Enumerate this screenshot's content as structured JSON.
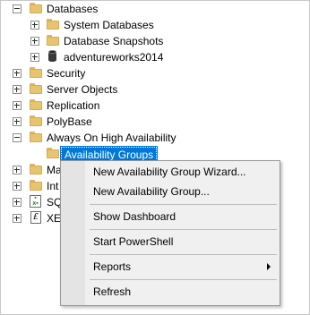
{
  "tree": {
    "databases": "Databases",
    "system_databases": "System Databases",
    "database_snapshots": "Database Snapshots",
    "adventureworks": "adventureworks2014",
    "security": "Security",
    "server_objects": "Server Objects",
    "replication": "Replication",
    "polybase": "PolyBase",
    "always_on": "Always On High Availability",
    "availability_groups": "Availability Groups",
    "management_partial": "Ma",
    "integration_partial": "Int",
    "sql_agent_partial": "SQ",
    "xevent_partial": "XE"
  },
  "menu": {
    "new_ag_wizard": "New Availability Group Wizard...",
    "new_ag": "New Availability Group...",
    "show_dashboard": "Show Dashboard",
    "start_powershell": "Start PowerShell",
    "reports": "Reports",
    "refresh": "Refresh"
  },
  "colors": {
    "selection": "#0078d7",
    "folder": "#e8c46f",
    "menu_bg": "#f0f0f0"
  }
}
